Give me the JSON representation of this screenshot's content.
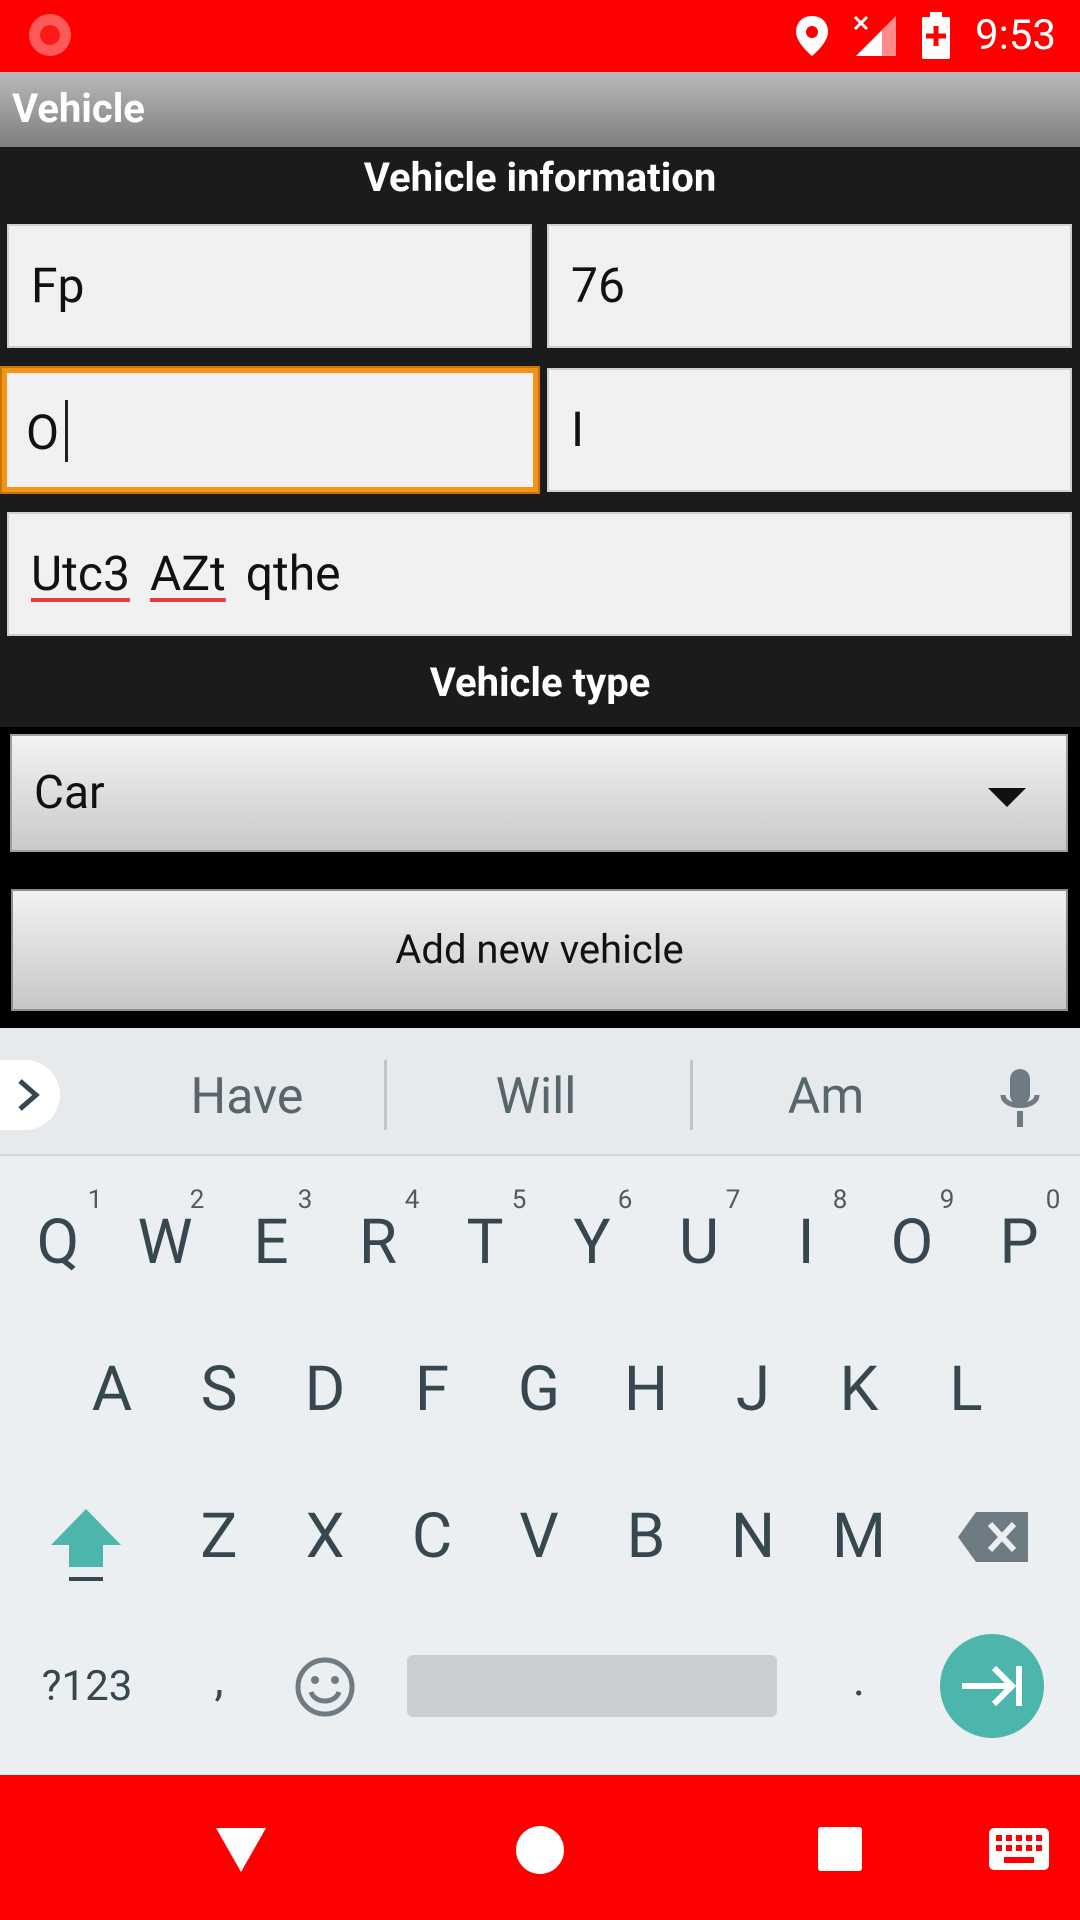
{
  "status_bar": {
    "time": "9:53"
  },
  "app": {
    "title": "Vehicle"
  },
  "sections": {
    "info_header": "Vehicle information",
    "type_header": "Vehicle type"
  },
  "fields": {
    "f1": "Fp",
    "f2": "76",
    "f3": "O",
    "f4": "I",
    "f5_words": [
      "Utc3",
      "AZt",
      "qthe"
    ]
  },
  "vehicle_type": {
    "selected": "Car"
  },
  "add_button": "Add new vehicle",
  "keyboard": {
    "suggestions": [
      "Have",
      "Will",
      "Am"
    ],
    "row1": [
      "Q",
      "W",
      "E",
      "R",
      "T",
      "Y",
      "U",
      "I",
      "O",
      "P"
    ],
    "row1_hints": [
      "1",
      "2",
      "3",
      "4",
      "5",
      "6",
      "7",
      "8",
      "9",
      "0"
    ],
    "row2": [
      "A",
      "S",
      "D",
      "F",
      "G",
      "H",
      "J",
      "K",
      "L"
    ],
    "row3": [
      "Z",
      "X",
      "C",
      "V",
      "B",
      "N",
      "M"
    ],
    "symbols_key": "?123",
    "comma": ",",
    "period": "."
  },
  "colors": {
    "status_bar": "#ff0000",
    "nav_bar": "#ff0000",
    "focus": "#f39318",
    "enter_key": "#4db6ac",
    "keyboard_bg": "#eceff1"
  },
  "icons": [
    "record-icon",
    "location-icon",
    "signal-icon",
    "battery-icon",
    "expand-icon",
    "mic-icon",
    "shift-icon",
    "backspace-icon",
    "emoji-icon",
    "enter-icon",
    "back-icon",
    "home-icon",
    "recents-icon",
    "keyboard-icon"
  ]
}
